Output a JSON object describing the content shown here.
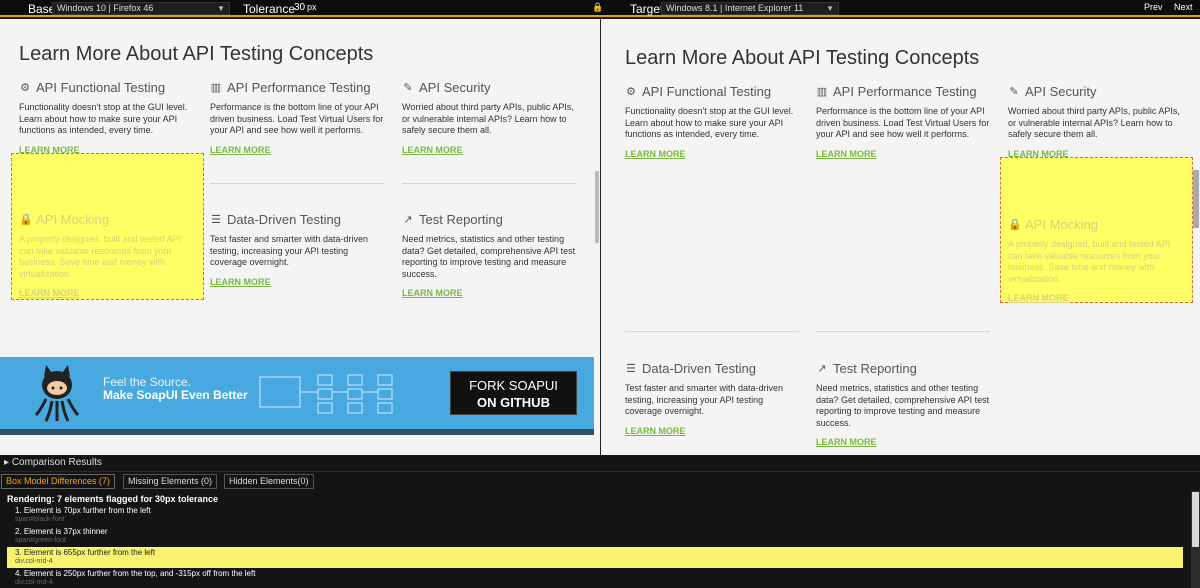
{
  "toolbar": {
    "base_label": "Base",
    "base_value": "Windows 10 | Firefox 46",
    "tolerance_label": "Tolerance",
    "tolerance_value": "30",
    "tolerance_unit": "px",
    "target_label": "Target",
    "target_value": "Windows 8.1 | Internet Explorer 11",
    "prev": "Prev",
    "next": "Next"
  },
  "page": {
    "heading": "Learn More About API Testing Concepts",
    "learn_more": "LEARN MORE",
    "cards": [
      {
        "title": "API Functional Testing",
        "icon": "gears-icon",
        "desc": "Functionality doesn't stop at the GUI level. Learn about how to make sure your API functions as intended, every time."
      },
      {
        "title": "API Performance Testing",
        "icon": "bar-chart-icon",
        "desc": "Performance is the bottom line of your API driven business. Load Test Virtual Users for your API and see how well it performs."
      },
      {
        "title": "API Security",
        "icon": "magic-wand-icon",
        "desc": "Worried about third party APIs, public APIs, or vulnerable internal APIs? Learn how to safely secure them all."
      },
      {
        "title": "API Mocking",
        "icon": "lock-icon",
        "desc": "A properly designed, built and tested API can take valuable resources from your business. Save time and money with virtualization."
      },
      {
        "title": "Data-Driven Testing",
        "icon": "database-icon",
        "desc": "Test faster and smarter with data-driven testing, increasing your API testing coverage overnight."
      },
      {
        "title": "Test Reporting",
        "icon": "line-chart-icon",
        "desc": "Need metrics, statistics and other testing data? Get detailed, comprehensive API test reporting to improve testing and measure success."
      }
    ],
    "banner": {
      "feel": "Feel the Source.",
      "make": "Make SoapUI Even Better",
      "fork_line1": "FORK SOAPUI",
      "fork_line2": "ON GITHUB"
    }
  },
  "results": {
    "title": "Comparison Results",
    "tabs": [
      "Box Model Differences (7)",
      "Missing Elements (0)",
      "Hidden Elements(0)"
    ],
    "summary": "Rendering: 7 elements flagged for 30px tolerance",
    "items": [
      {
        "msg": "1. Element is 70px further from the left",
        "selector": "span#black-font"
      },
      {
        "msg": "2. Element is 37px thinner",
        "selector": "span#green-font"
      },
      {
        "msg": "3. Element is 655px further from the left",
        "selector": "div.col-md-4"
      },
      {
        "msg": "4. Element is 250px further from the top, and -315px off from the left",
        "selector": "div.col-md-4"
      }
    ]
  },
  "colors": {
    "accent": "#f0a21d",
    "highlight": "#ffff5e",
    "link_green": "#7ab842",
    "banner_blue": "#48a8e0"
  }
}
